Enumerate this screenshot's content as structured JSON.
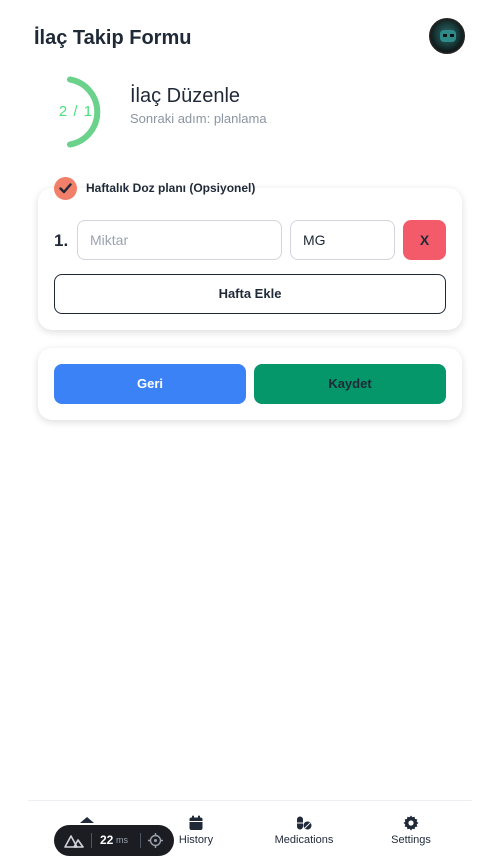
{
  "header": {
    "title": "İlaç Takip Formu"
  },
  "stepper": {
    "progress_text": "2 / 1",
    "title": "İlaç Düzenle",
    "subtitle": "Sonraki adım: planlama",
    "progress_fraction": 0.5,
    "ring_color": "#6ad28a"
  },
  "dose_plan": {
    "checked": true,
    "title": "Haftalık Doz planı (Opsiyonel)",
    "rows": [
      {
        "number": "1.",
        "amount_placeholder": "Miktar",
        "amount_value": "",
        "unit": "MG",
        "remove_label": "X"
      }
    ],
    "add_week_label": "Hafta Ekle"
  },
  "actions": {
    "back_label": "Geri",
    "save_label": "Kaydet"
  },
  "bottom_nav": {
    "items": [
      {
        "label": "",
        "icon": "home-icon"
      },
      {
        "label": "History",
        "icon": "calendar-icon"
      },
      {
        "label": "Medications",
        "icon": "pills-icon"
      },
      {
        "label": "Settings",
        "icon": "gear-icon"
      }
    ]
  },
  "devtools": {
    "render_time": "22",
    "unit": "ms"
  },
  "colors": {
    "accent_blue": "#3b82f6",
    "accent_green": "#059669",
    "danger": "#f45b6a",
    "check": "#f27f6a"
  }
}
